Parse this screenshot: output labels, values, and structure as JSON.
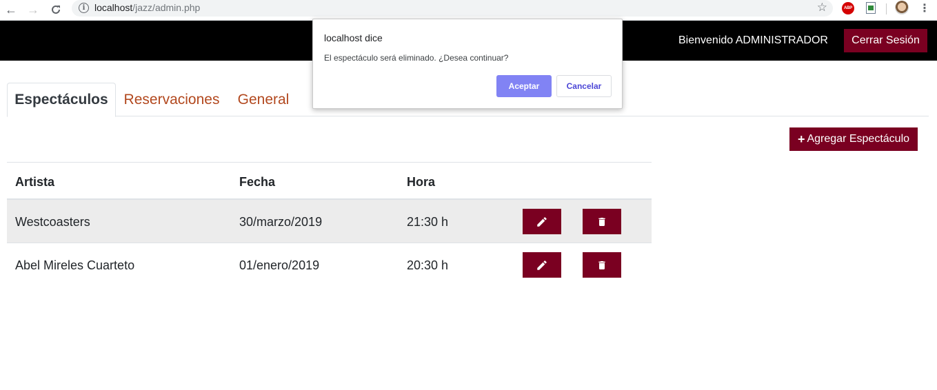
{
  "browser": {
    "url_host": "localhost",
    "url_path": "/jazz/admin.php",
    "extension_abp": "ABP"
  },
  "header": {
    "welcome": "Bienvenido ADMINISTRADOR",
    "logout_label": "Cerrar Sesión"
  },
  "tabs": [
    {
      "label": "Espectáculos",
      "active": true
    },
    {
      "label": "Reservaciones",
      "active": false
    },
    {
      "label": "General",
      "active": false
    }
  ],
  "actions": {
    "add_label": "Agregar Espectáculo"
  },
  "table": {
    "columns": [
      "Artista",
      "Fecha",
      "Hora"
    ],
    "rows": [
      {
        "artista": "Westcoasters",
        "fecha": "30/marzo/2019",
        "hora": "21:30 h"
      },
      {
        "artista": "Abel Mireles Cuarteto",
        "fecha": "01/enero/2019",
        "hora": "20:30 h"
      }
    ]
  },
  "dialog": {
    "title": "localhost dice",
    "message": "El espectáculo será eliminado. ¿Desea continuar?",
    "ok_label": "Aceptar",
    "cancel_label": "Cancelar"
  },
  "colors": {
    "brand": "#7a0021",
    "header_bg": "#000000",
    "tab_link": "#b2481e",
    "dialog_primary": "#8183f4"
  },
  "icons": {
    "edit": "pencil-icon",
    "delete": "trash-icon"
  }
}
